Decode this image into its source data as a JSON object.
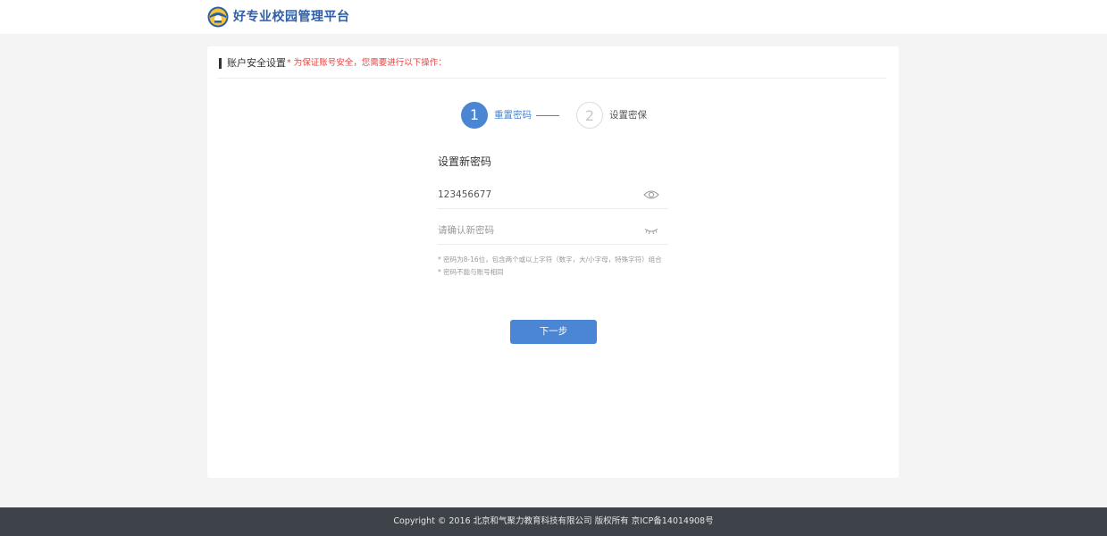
{
  "header": {
    "brand_name": "好专业校园管理平台",
    "logo_icon": "campus-logo-icon"
  },
  "section": {
    "title": "账户安全设置",
    "note": "* 为保证账号安全，您需要进行以下操作："
  },
  "steps": [
    {
      "number": "1",
      "label": "重置密码",
      "state": "active"
    },
    {
      "number": "2",
      "label": "设置密保",
      "state": "inactive"
    }
  ],
  "form": {
    "title": "设置新密码",
    "new_password_value": "123456677",
    "confirm_password_placeholder": "请确认新密码",
    "show_password_icon": "eye-open-icon",
    "hide_password_icon": "eye-closed-icon",
    "hints": [
      "* 密码为8-16位，包含两个或以上字符（数字，大/小字母，特殊字符）组合",
      "* 密码不能与账号相同"
    ],
    "next_button_label": "下一步"
  },
  "footer": {
    "copyright": "Copyright © 2016 北京和气聚力教育科技有限公司 版权所有 京ICP备14014908号"
  },
  "colors": {
    "accent": "#4a86d3",
    "warning": "#e64545",
    "footer_bg": "#3e4349",
    "page_bg": "#f4f4f4"
  }
}
